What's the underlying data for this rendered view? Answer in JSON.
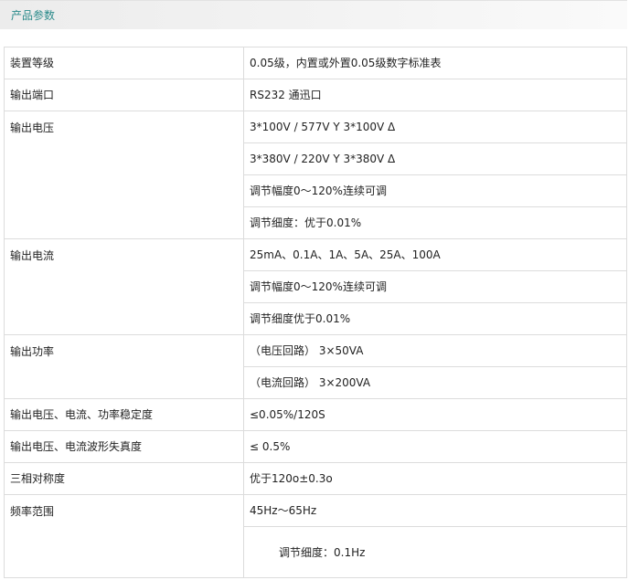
{
  "header": {
    "title": "产品参数"
  },
  "rows": [
    {
      "label": "装置等级",
      "values": [
        "0.05级，内置或外置0.05级数字标准表"
      ]
    },
    {
      "label": "输出端口",
      "values": [
        "RS232 通迅口"
      ]
    },
    {
      "label": "输出电压",
      "values": [
        "3*100V / 577V Y 3*100V Δ",
        "3*380V / 220V Y 3*380V Δ",
        "调节幅度0～120%连续可调",
        "调节细度：优于0.01%"
      ]
    },
    {
      "label": "输出电流",
      "values": [
        "25mA、0.1A、1A、5A、25A、100A",
        "调节幅度0～120%连续可调",
        "调节细度优于0.01%"
      ]
    },
    {
      "label": "输出功率",
      "values": [
        "（电压回路） 3×50VA",
        "（电流回路） 3×200VA"
      ]
    },
    {
      "label": "输出电压、电流、功率稳定度",
      "values": [
        "≤0.05%/120S"
      ]
    },
    {
      "label": "输出电压、电流波形失真度",
      "values": [
        "≤ 0.5%"
      ]
    },
    {
      "label": "三相对称度",
      "values": [
        "优于120o±0.3o"
      ]
    },
    {
      "label": "频率范围",
      "values": [
        "45Hz～65Hz",
        "调节细度：0.1Hz"
      ]
    }
  ]
}
